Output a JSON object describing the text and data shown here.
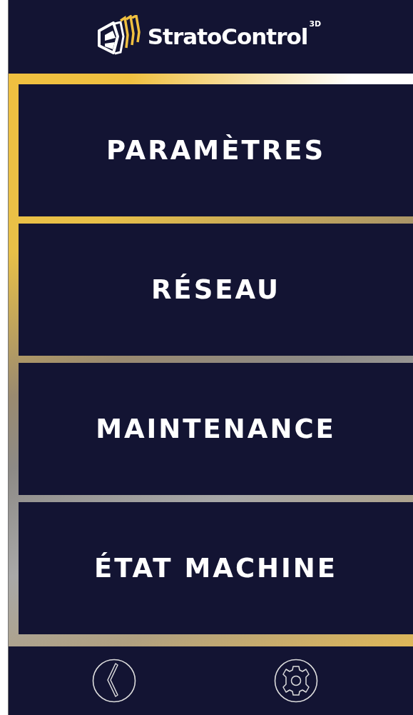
{
  "header": {
    "logo_text": "StratoControl",
    "logo_superscript": "3D"
  },
  "menu": [
    {
      "label": "PARAMÈTRES"
    },
    {
      "label": "RÉSEAU"
    },
    {
      "label": "MAINTENANCE"
    },
    {
      "label": "ÉTAT MACHINE"
    }
  ],
  "footer": {
    "buttons": [
      {
        "kind": "back"
      },
      {
        "kind": "settings"
      }
    ]
  }
}
